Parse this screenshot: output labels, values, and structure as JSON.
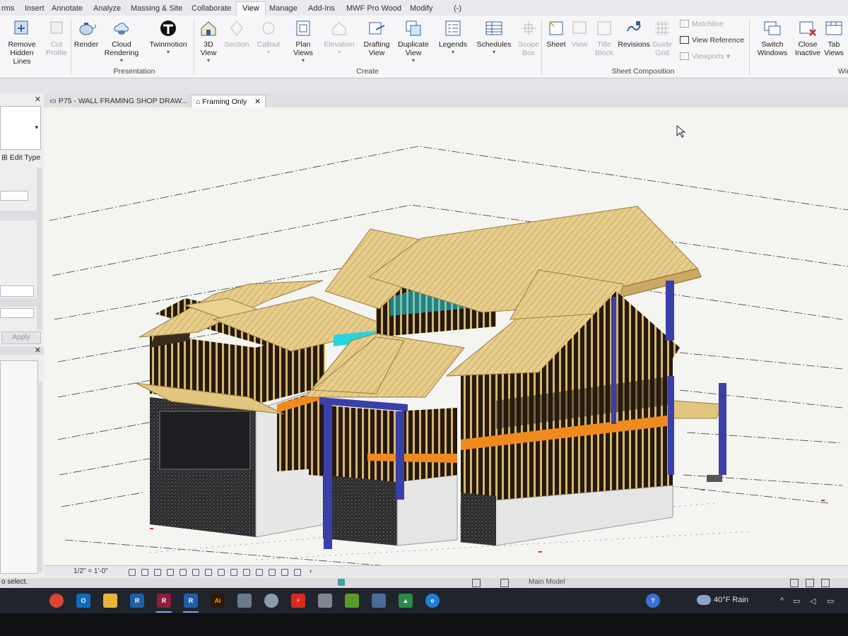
{
  "ribbon_tabs": [
    "rms",
    "Insert",
    "Annotate",
    "Analyze",
    "Massing & Site",
    "Collaborate",
    "View",
    "Manage",
    "Add-Ins",
    "MWF Pro Wood",
    "Modify",
    "(-)"
  ],
  "ribbon": {
    "buttons": [
      {
        "label1": "Remove",
        "label2": "Hidden Lines",
        "icon": "remove-hidden-lines-icon"
      },
      {
        "label1": "Cut",
        "label2": "Profile",
        "icon": "cut-profile-icon"
      },
      {
        "label1": "Render",
        "label2": "",
        "icon": "render-teapot-icon"
      },
      {
        "label1": "Cloud",
        "label2": "Rendering",
        "icon": "cloud-rendering-icon"
      },
      {
        "label1": "Twinmotion",
        "label2": "",
        "icon": "twinmotion-icon"
      },
      {
        "label1": "3D",
        "label2": "View",
        "icon": "3d-view-house-icon"
      },
      {
        "label1": "Section",
        "label2": "",
        "icon": "section-icon"
      },
      {
        "label1": "Callout",
        "label2": "",
        "icon": "callout-icon"
      },
      {
        "label1": "Plan",
        "label2": "Views",
        "icon": "plan-views-icon"
      },
      {
        "label1": "Elevation",
        "label2": "",
        "icon": "elevation-icon"
      },
      {
        "label1": "Drafting",
        "label2": "View",
        "icon": "drafting-view-icon"
      },
      {
        "label1": "Duplicate",
        "label2": "View",
        "icon": "duplicate-view-icon"
      },
      {
        "label1": "Legends",
        "label2": "",
        "icon": "legends-icon"
      },
      {
        "label1": "Schedules",
        "label2": "",
        "icon": "schedules-icon"
      },
      {
        "label1": "Scope",
        "label2": "Box",
        "icon": "scope-box-icon"
      },
      {
        "label1": "Sheet",
        "label2": "",
        "icon": "sheet-icon"
      },
      {
        "label1": "View",
        "label2": "",
        "icon": "place-view-icon"
      },
      {
        "label1": "Title",
        "label2": "Block",
        "icon": "title-block-icon"
      },
      {
        "label1": "Revisions",
        "label2": "",
        "icon": "revisions-icon"
      },
      {
        "label1": "Guide",
        "label2": "Grid",
        "icon": "guide-grid-icon"
      },
      {
        "label1": "Switch",
        "label2": "Windows",
        "icon": "switch-windows-icon"
      },
      {
        "label1": "Close",
        "label2": "Inactive",
        "icon": "close-inactive-icon"
      },
      {
        "label1": "Tab",
        "label2": "Views",
        "icon": "tab-views-icon"
      }
    ],
    "small_items": [
      "Matchline",
      "View Reference",
      "Viewports"
    ],
    "groups": [
      "Presentation",
      "Create",
      "Sheet Composition",
      "Win"
    ]
  },
  "properties": {
    "edit_type": "Edit Type",
    "apply": "Apply"
  },
  "doc_tabs": [
    {
      "label": "P75 - WALL FRAMING SHOP DRAW...",
      "active": false
    },
    {
      "label": "Framing Only",
      "active": true
    }
  ],
  "viewbar": {
    "scale": "1/2\" = 1'-0\""
  },
  "status": {
    "text": "o select.",
    "model": "Main Model"
  },
  "taskbar": {
    "apps": [
      "chrome",
      "outlook",
      "file-explorer",
      "revit",
      "revit",
      "revit",
      "illustrator",
      "calculator",
      "photo-app",
      "acrobat",
      "files",
      "nvidia",
      "app",
      "google-drive",
      "edge"
    ],
    "weather": "40°F  Rain"
  },
  "colors": {
    "accent_blue": "#3b6fd4",
    "roof": "#e8cf8f",
    "stud": "#d4b36a",
    "beam_orange": "#f08a1e",
    "column_blue": "#3b3fa8",
    "glass_cyan": "#2ad3e0",
    "concrete": "#2c2c2e"
  }
}
